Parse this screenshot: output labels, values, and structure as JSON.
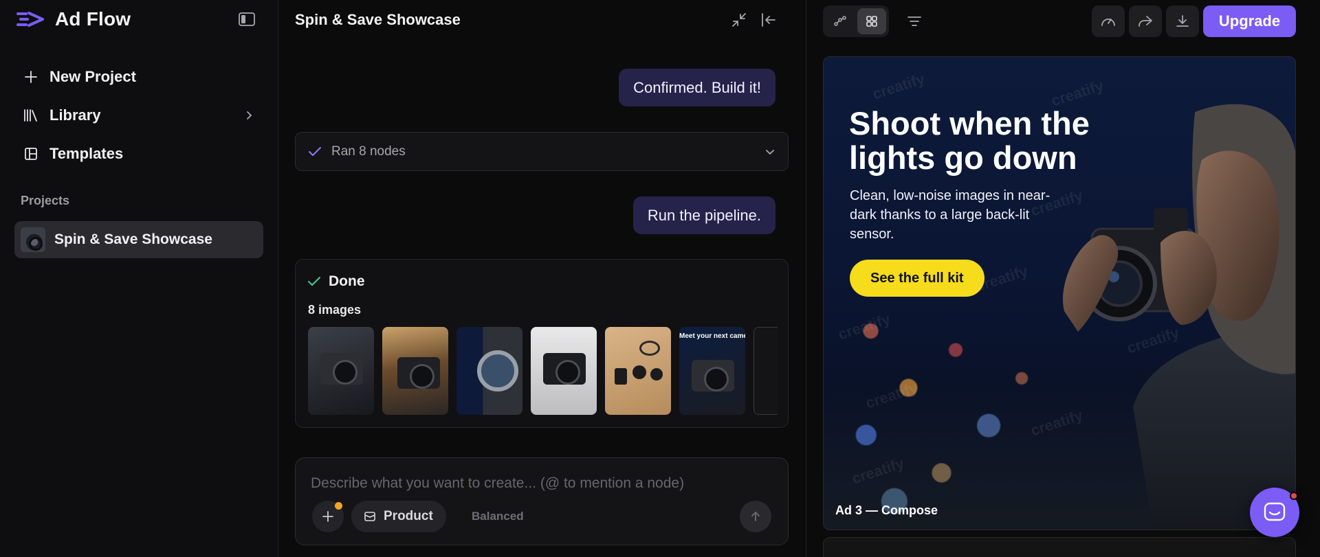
{
  "brand": {
    "name": "Ad Flow"
  },
  "sidebar": {
    "items": [
      {
        "label": "New Project",
        "icon": "plus-icon"
      },
      {
        "label": "Library",
        "icon": "library-icon"
      },
      {
        "label": "Templates",
        "icon": "templates-icon"
      }
    ],
    "projects_label": "Projects",
    "projects": [
      {
        "label": "Spin & Save Showcase",
        "active": true
      }
    ]
  },
  "chat": {
    "title": "Spin & Save Showcase",
    "messages": [
      {
        "role": "user",
        "text": "Confirmed. Build it!"
      },
      {
        "role": "user",
        "text": "Run the pipeline."
      }
    ],
    "nodes_status": "Ran 8 nodes",
    "result": {
      "status": "Done",
      "count_label": "8 images",
      "thumb_caption": "Meet your next camera"
    },
    "composer": {
      "placeholder": "Describe what you want to create... (@ to mention a node)",
      "chip_label": "Product",
      "mode_label": "Balanced"
    }
  },
  "canvas": {
    "upgrade_label": "Upgrade",
    "ad": {
      "headline": "Shoot when the lights go down",
      "subtext": "Clean, low-noise images in near-dark thanks to a large back-lit sensor.",
      "cta": "See the full kit",
      "caption": "Ad 3 — Compose",
      "watermark": "creatify"
    }
  },
  "colors": {
    "accent": "#7b5cf5",
    "user_bubble": "#25234a",
    "cta_yellow": "#f6dc1b",
    "success_green": "#3ecf8e",
    "notification_red": "#e5484d"
  }
}
